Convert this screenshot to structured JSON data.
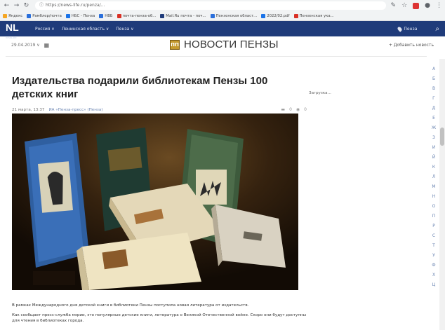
{
  "browser": {
    "url": "https://news-life.ru/penza/...",
    "bookmarks": [
      {
        "label": "Яндекс",
        "color": "#f5a623"
      },
      {
        "label": "Рамблер/почта",
        "color": "#2a6fdb"
      },
      {
        "label": "НБС - Пенза",
        "color": "#1a73e8"
      },
      {
        "label": "НВБ",
        "color": "#2a6fdb"
      },
      {
        "label": "почта-пенза-об...",
        "color": "#d93025"
      },
      {
        "label": "Mail.Ru почта - поч...",
        "color": "#1f3b7a"
      },
      {
        "label": "Пензенская област...",
        "color": "#2a6fdb"
      },
      {
        "label": "2022/02.pdf",
        "color": "#1a73e8"
      },
      {
        "label": "Пензенская ука...",
        "color": "#d93025"
      }
    ]
  },
  "site_nav": {
    "logo": "NL",
    "logo_sub": "news.life",
    "menu": [
      "Россия ∨",
      "Ленинская область ∨",
      "Пенза ∨"
    ],
    "city": "Пенза"
  },
  "subbar": {
    "date": "29.04.2019 ∨",
    "brand_emblem": "ПП",
    "brand_name": "НОВОСТИ ПЕНЗЫ",
    "add_news": "+ Добавить новость"
  },
  "article": {
    "title": "Издательства подарили библиотекам Пензы 100 детских книг",
    "date": "21 марта, 13:37",
    "source": "ИА «Пенза-пресс» (Пенза)",
    "comment_count": "0",
    "view_count": "0",
    "paragraphs": [
      "В рамках Международного дня детской книги в библиотеки Пензы поступила новая литература от издательств.",
      "Как сообщает пресс-служба мэрии, это популярные детские книги, литература о Великой Отечественной войне. Скоро они будут доступны для чтения в библиотеках города."
    ]
  },
  "sidebar": {
    "loading_text": "Загрузка..."
  },
  "alphabet": [
    "А",
    "Б",
    "В",
    "Г",
    "Д",
    "Е",
    "Ж",
    "З",
    "И",
    "Й",
    "К",
    "Л",
    "М",
    "Н",
    "О",
    "П",
    "Р",
    "С",
    "Т",
    "У",
    "Ф",
    "Х",
    "Ц"
  ]
}
